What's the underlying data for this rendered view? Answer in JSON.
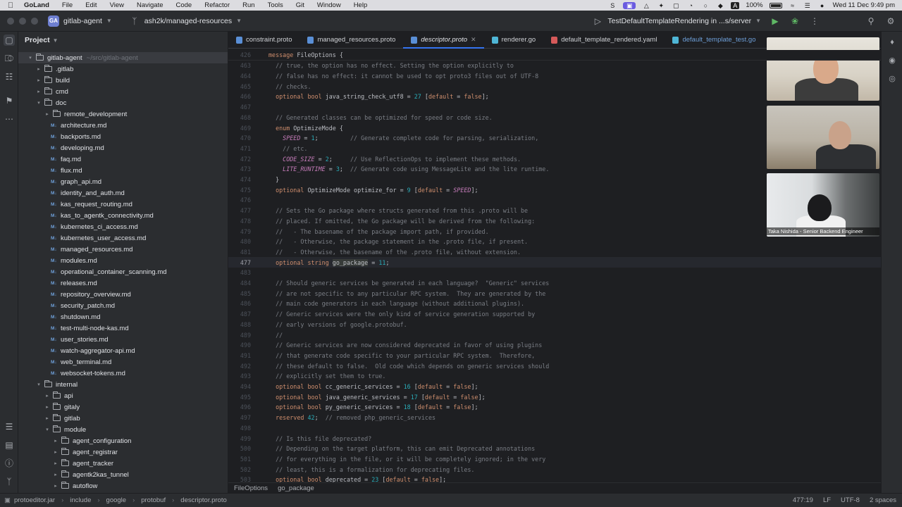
{
  "menubar": {
    "app": "GoLand",
    "items": [
      "File",
      "Edit",
      "View",
      "Navigate",
      "Code",
      "Refactor",
      "Run",
      "Tools",
      "Git",
      "Window",
      "Help"
    ],
    "battery": "100%",
    "datetime": "Wed 11 Dec 9:49 pm"
  },
  "toolbar": {
    "project_badge": "GA",
    "project": "gitlab-agent",
    "branch": "ash2k/managed-resources",
    "run_config": "TestDefaultTemplateRendering in ...s/server"
  },
  "project_panel": {
    "title": "Project",
    "tree": [
      {
        "label": "gitlab-agent",
        "path": "~/src/gitlab-agent",
        "kind": "folder",
        "depth": 0,
        "expanded": true
      },
      {
        "label": ".gitlab",
        "kind": "folder",
        "depth": 1,
        "expanded": false
      },
      {
        "label": "build",
        "kind": "folder",
        "depth": 1,
        "expanded": false
      },
      {
        "label": "cmd",
        "kind": "folder",
        "depth": 1,
        "expanded": false
      },
      {
        "label": "doc",
        "kind": "folder",
        "depth": 1,
        "expanded": true
      },
      {
        "label": "remote_development",
        "kind": "folder",
        "depth": 2,
        "expanded": false
      },
      {
        "label": "architecture.md",
        "kind": "md",
        "depth": 2
      },
      {
        "label": "backports.md",
        "kind": "md",
        "depth": 2
      },
      {
        "label": "developing.md",
        "kind": "md",
        "depth": 2
      },
      {
        "label": "faq.md",
        "kind": "md",
        "depth": 2
      },
      {
        "label": "flux.md",
        "kind": "md",
        "depth": 2
      },
      {
        "label": "graph_api.md",
        "kind": "md",
        "depth": 2
      },
      {
        "label": "identity_and_auth.md",
        "kind": "md",
        "depth": 2
      },
      {
        "label": "kas_request_routing.md",
        "kind": "md",
        "depth": 2
      },
      {
        "label": "kas_to_agentk_connectivity.md",
        "kind": "md",
        "depth": 2
      },
      {
        "label": "kubernetes_ci_access.md",
        "kind": "md",
        "depth": 2
      },
      {
        "label": "kubernetes_user_access.md",
        "kind": "md",
        "depth": 2
      },
      {
        "label": "managed_resources.md",
        "kind": "md",
        "depth": 2
      },
      {
        "label": "modules.md",
        "kind": "md",
        "depth": 2
      },
      {
        "label": "operational_container_scanning.md",
        "kind": "md",
        "depth": 2
      },
      {
        "label": "releases.md",
        "kind": "md",
        "depth": 2
      },
      {
        "label": "repository_overview.md",
        "kind": "md",
        "depth": 2
      },
      {
        "label": "security_patch.md",
        "kind": "md",
        "depth": 2
      },
      {
        "label": "shutdown.md",
        "kind": "md",
        "depth": 2
      },
      {
        "label": "test-multi-node-kas.md",
        "kind": "md",
        "depth": 2
      },
      {
        "label": "user_stories.md",
        "kind": "md",
        "depth": 2
      },
      {
        "label": "watch-aggregator-api.md",
        "kind": "md",
        "depth": 2
      },
      {
        "label": "web_terminal.md",
        "kind": "md",
        "depth": 2
      },
      {
        "label": "websocket-tokens.md",
        "kind": "md",
        "depth": 2
      },
      {
        "label": "internal",
        "kind": "folder",
        "depth": 1,
        "expanded": true
      },
      {
        "label": "api",
        "kind": "folder",
        "depth": 2,
        "expanded": false
      },
      {
        "label": "gitaly",
        "kind": "folder",
        "depth": 2,
        "expanded": false
      },
      {
        "label": "gitlab",
        "kind": "folder",
        "depth": 2,
        "expanded": false
      },
      {
        "label": "module",
        "kind": "folder",
        "depth": 2,
        "expanded": true
      },
      {
        "label": "agent_configuration",
        "kind": "folder",
        "depth": 3,
        "expanded": false
      },
      {
        "label": "agent_registrar",
        "kind": "folder",
        "depth": 3,
        "expanded": false
      },
      {
        "label": "agent_tracker",
        "kind": "folder",
        "depth": 3,
        "expanded": false
      },
      {
        "label": "agentk2kas_tunnel",
        "kind": "folder",
        "depth": 3,
        "expanded": false
      },
      {
        "label": "autoflow",
        "kind": "folder",
        "depth": 3,
        "expanded": false
      }
    ]
  },
  "tabs": [
    {
      "label": "constraint.proto",
      "icon": "proto",
      "active": false
    },
    {
      "label": "managed_resources.proto",
      "icon": "proto",
      "active": false
    },
    {
      "label": "descriptor.proto",
      "icon": "proto",
      "active": true
    },
    {
      "label": "renderer.go",
      "icon": "go",
      "active": false
    },
    {
      "label": "default_template_rendered.yaml",
      "icon": "yaml",
      "active": false
    },
    {
      "label": "default_template_test.go",
      "icon": "go",
      "active": false
    }
  ],
  "editor": {
    "sticky": {
      "ln": "426",
      "text": "message FileOptions {"
    },
    "current_line": "477",
    "lines": [
      {
        "ln": "463",
        "text": "  // true, the option has no effect. Setting the option explicitly to"
      },
      {
        "ln": "464",
        "text": "  // false has no effect: it cannot be used to opt proto3 files out of UTF-8"
      },
      {
        "ln": "465",
        "text": "  // checks."
      },
      {
        "ln": "466",
        "text": "  optional bool java_string_check_utf8 = 27 [default = false];"
      },
      {
        "ln": "467",
        "text": ""
      },
      {
        "ln": "468",
        "text": "  // Generated classes can be optimized for speed or code size."
      },
      {
        "ln": "469",
        "text": "  enum OptimizeMode {"
      },
      {
        "ln": "470",
        "text": "    SPEED = 1;         // Generate complete code for parsing, serialization,"
      },
      {
        "ln": "471",
        "text": "    // etc."
      },
      {
        "ln": "472",
        "text": "    CODE_SIZE = 2;     // Use ReflectionOps to implement these methods."
      },
      {
        "ln": "473",
        "text": "    LITE_RUNTIME = 3;  // Generate code using MessageLite and the lite runtime."
      },
      {
        "ln": "474",
        "text": "  }"
      },
      {
        "ln": "475",
        "text": "  optional OptimizeMode optimize_for = 9 [default = SPEED];"
      },
      {
        "ln": "476",
        "text": ""
      },
      {
        "ln": "477",
        "text": "  // Sets the Go package where structs generated from this .proto will be"
      },
      {
        "ln": "478",
        "text": "  // placed. If omitted, the Go package will be derived from the following:"
      },
      {
        "ln": "479",
        "text": "  //   - The basename of the package import path, if provided."
      },
      {
        "ln": "480",
        "text": "  //   - Otherwise, the package statement in the .proto file, if present."
      },
      {
        "ln": "481",
        "text": "  //   - Otherwise, the basename of the .proto file, without extension."
      },
      {
        "ln": "477",
        "text": "  optional string go_package = 11;"
      },
      {
        "ln": "483",
        "text": ""
      },
      {
        "ln": "484",
        "text": "  // Should generic services be generated in each language?  \"Generic\" services"
      },
      {
        "ln": "485",
        "text": "  // are not specific to any particular RPC system.  They are generated by the"
      },
      {
        "ln": "486",
        "text": "  // main code generators in each language (without additional plugins)."
      },
      {
        "ln": "487",
        "text": "  // Generic services were the only kind of service generation supported by"
      },
      {
        "ln": "488",
        "text": "  // early versions of google.protobuf."
      },
      {
        "ln": "489",
        "text": "  //"
      },
      {
        "ln": "490",
        "text": "  // Generic services are now considered deprecated in favor of using plugins"
      },
      {
        "ln": "491",
        "text": "  // that generate code specific to your particular RPC system.  Therefore,"
      },
      {
        "ln": "492",
        "text": "  // these default to false.  Old code which depends on generic services should"
      },
      {
        "ln": "493",
        "text": "  // explicitly set them to true."
      },
      {
        "ln": "494",
        "text": "  optional bool cc_generic_services = 16 [default = false];"
      },
      {
        "ln": "495",
        "text": "  optional bool java_generic_services = 17 [default = false];"
      },
      {
        "ln": "496",
        "text": "  optional bool py_generic_services = 18 [default = false];"
      },
      {
        "ln": "497",
        "text": "  reserved 42;  // removed php_generic_services"
      },
      {
        "ln": "498",
        "text": ""
      },
      {
        "ln": "499",
        "text": "  // Is this file deprecated?"
      },
      {
        "ln": "500",
        "text": "  // Depending on the target platform, this can emit Deprecated annotations"
      },
      {
        "ln": "501",
        "text": "  // for everything in the file, or it will be completely ignored; in the very"
      },
      {
        "ln": "502",
        "text": "  // least, this is a formalization for deprecating files."
      },
      {
        "ln": "503",
        "text": "  optional bool deprecated = 23 [default = false];"
      }
    ]
  },
  "code_breadcrumb": [
    "FileOptions",
    "go_package"
  ],
  "statusbar": {
    "crumbs": [
      "protoeditor.jar",
      "include",
      "google",
      "protobuf",
      "descriptor.proto"
    ],
    "position": "477:19",
    "line_ending": "LF",
    "encoding": "UTF-8",
    "indent": "2 spaces"
  },
  "video_call": {
    "caption": "Taka Nishida - Senior Backend Engineer"
  }
}
